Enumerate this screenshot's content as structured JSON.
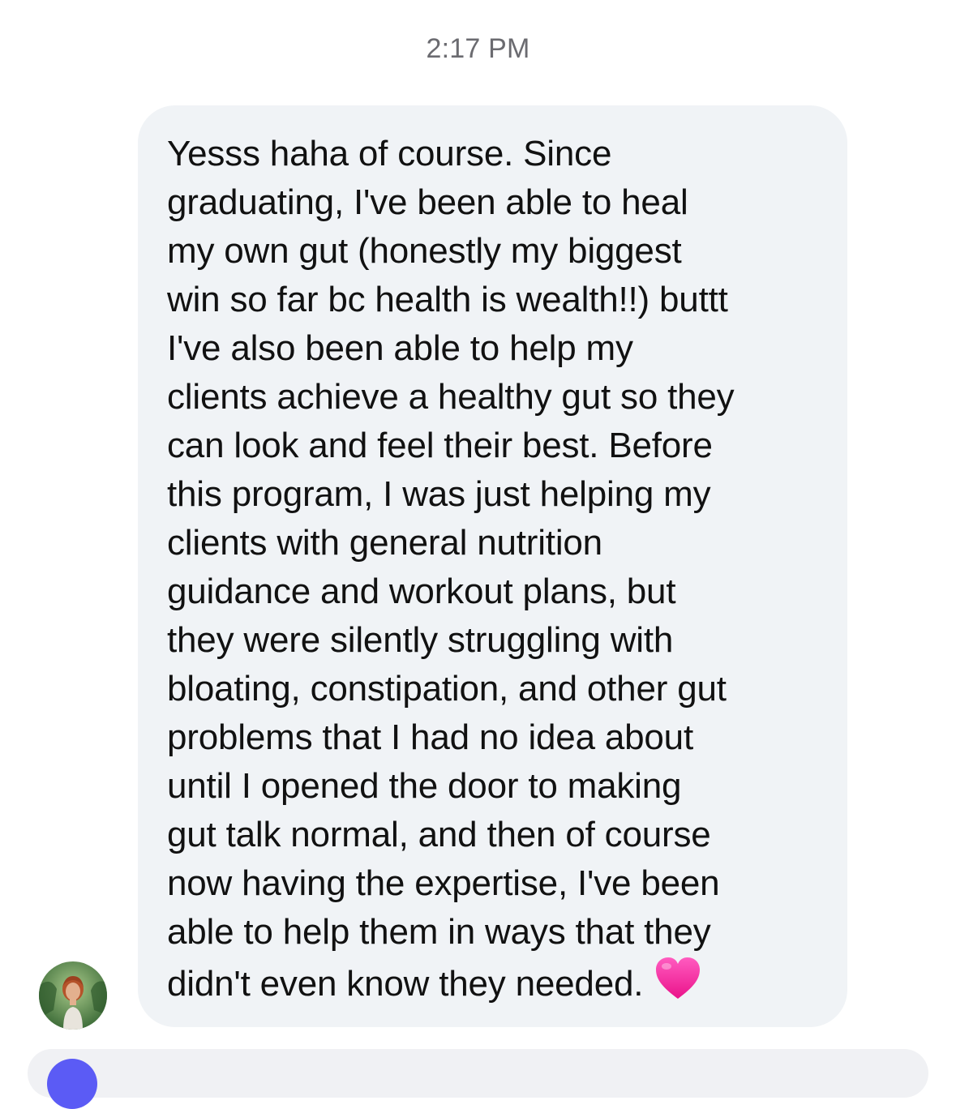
{
  "chat": {
    "timestamp": "2:17 PM",
    "message": {
      "lines": [
        "Yesss haha of course. Since",
        "graduating, I've been able to heal",
        "my own gut (honestly my biggest",
        "win so far bc health is wealth!!) buttt",
        "I've also been able to help my",
        "clients achieve a healthy gut so they",
        "can look and feel their best. Before",
        "this program, I was just helping my",
        "clients with general nutrition",
        "guidance and workout plans, but",
        "they were silently struggling with",
        "bloating, constipation, and other gut",
        "problems that I had no idea about",
        "until I opened the door to making",
        "gut talk normal, and then of course",
        "now having the expertise, I've been",
        "able to help them in ways that they",
        "didn't even know they needed."
      ],
      "trailing_emoji": "pink-heart-icon"
    }
  },
  "colors": {
    "bubble": "#f0f3f6",
    "timestamp": "#6b6b70",
    "text": "#111111",
    "heart": "#ff2fa3",
    "accent": "#5b5bf5"
  }
}
